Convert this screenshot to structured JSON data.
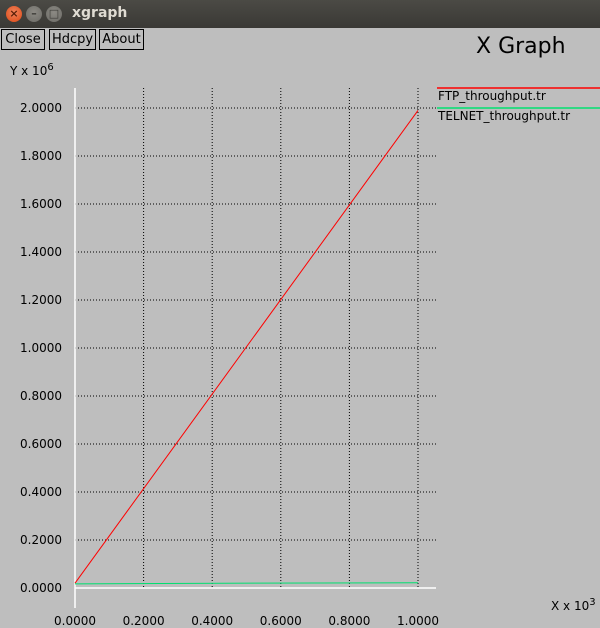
{
  "window": {
    "title": "xgraph",
    "close_glyph": "×",
    "min_glyph": "–",
    "max_glyph": "□"
  },
  "toolbar": {
    "close_label": "Close",
    "hdcpy_label": "Hdcpy",
    "about_label": "About"
  },
  "graph": {
    "title": "X Graph",
    "y_unit_base": "Y x 10",
    "y_unit_exp": "6",
    "x_unit_base": "X x 10",
    "x_unit_exp": "3"
  },
  "chart_data": {
    "type": "line",
    "title": "X Graph",
    "xlabel": "X x 10^3",
    "ylabel": "Y x 10^6",
    "xlim": [
      0.0,
      1.0
    ],
    "ylim": [
      0.0,
      2.0
    ],
    "x_ticks": [
      "0.0000",
      "0.2000",
      "0.4000",
      "0.6000",
      "0.8000",
      "1.0000"
    ],
    "y_ticks": [
      "0.0000",
      "0.2000",
      "0.4000",
      "0.6000",
      "0.8000",
      "1.0000",
      "1.2000",
      "1.4000",
      "1.6000",
      "1.8000",
      "2.0000"
    ],
    "grid": true,
    "legend_position": "right",
    "series": [
      {
        "name": "FTP_throughput.tr",
        "color": "#ff0000",
        "x": [
          0.0,
          1.0
        ],
        "y": [
          0.02,
          1.99
        ]
      },
      {
        "name": "TELNET_throughput.tr",
        "color": "#00e070",
        "x": [
          0.0,
          0.25,
          1.0
        ],
        "y": [
          0.017,
          0.019,
          0.022
        ]
      }
    ]
  }
}
